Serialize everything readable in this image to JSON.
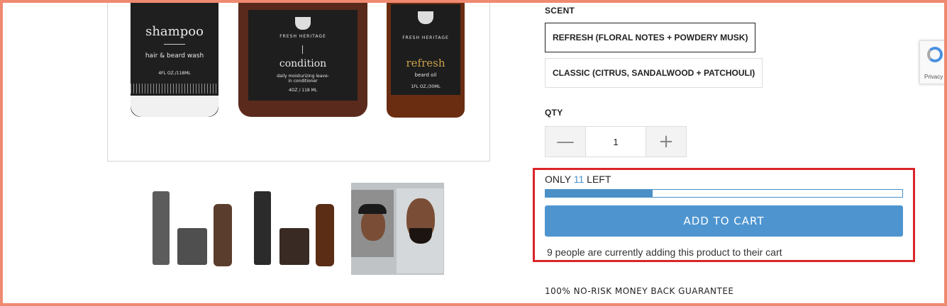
{
  "product_images": {
    "main": {
      "bottle_1": {
        "name": "shampoo",
        "sub": "hair & beard wash",
        "size": "4FL OZ./118ML"
      },
      "bottle_2": {
        "brand": "FRESH HERITAGE",
        "name": "condition",
        "sub": "daily moisturizing leave-in conditioner",
        "size": "4OZ / 118 ML"
      },
      "bottle_3": {
        "brand": "FRESH HERITAGE",
        "name": "refresh",
        "sub": "beard oil",
        "size": "1FL OZ./30ML"
      }
    },
    "thumbnails": [
      "product-set-thumbnail",
      "product-set-thumbnail",
      "before-after-thumbnail"
    ]
  },
  "scent": {
    "label": "SCENT",
    "options": [
      {
        "label": "REFRESH (FLORAL NOTES + POWDERY MUSK)",
        "selected": true
      },
      {
        "label": "CLASSIC (CITRUS, SANDALWOOD + PATCHOULI)",
        "selected": false
      }
    ]
  },
  "qty": {
    "label": "QTY",
    "value": "1",
    "minus_icon": "minus-icon",
    "plus_icon": "plus-icon"
  },
  "stock": {
    "prefix": "ONLY",
    "count": "11",
    "suffix": "LEFT",
    "fill_fraction": 0.3
  },
  "cart": {
    "button_label": "ADD TO CART",
    "people_text": "9 people are currently adding this product to their cart"
  },
  "guarantee": "100% NO-RISK MONEY BACK GUARANTEE",
  "recaptcha": {
    "text": "Privacy"
  },
  "colors": {
    "accent": "#4e95d0",
    "annotation": "#d9262b",
    "frame": "#ef8a70"
  }
}
